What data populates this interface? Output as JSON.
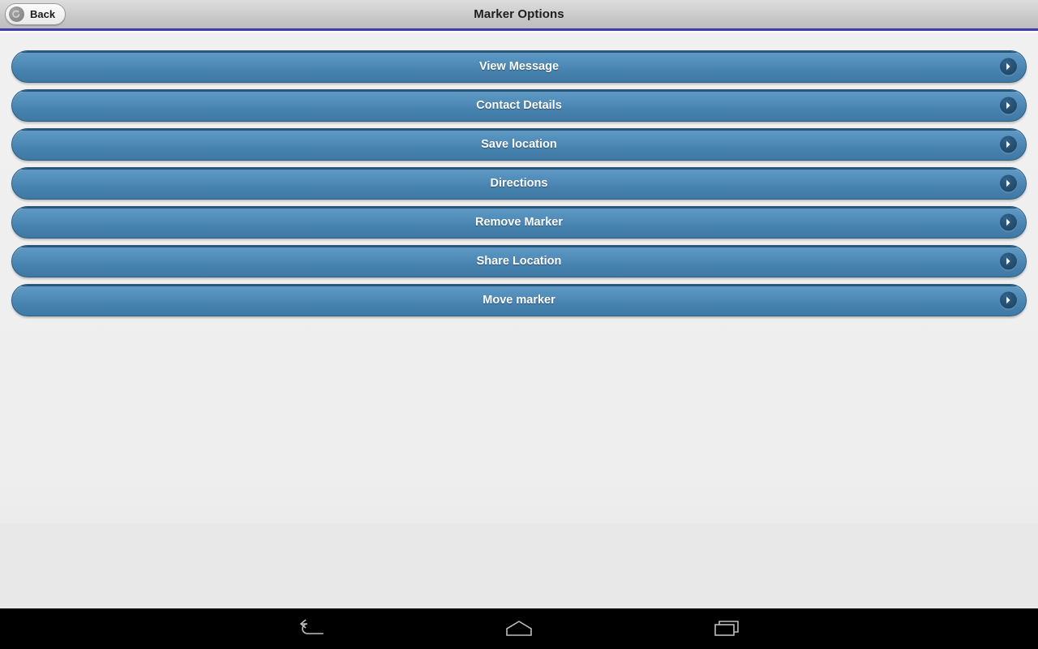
{
  "titlebar": {
    "title": "Marker Options",
    "back_label": "Back",
    "back_icon": "back-circle-arrow-icon",
    "accent_color": "#3c3cab"
  },
  "theme": {
    "button_blue_top": "#619ac6",
    "button_blue_bottom": "#3f79a5",
    "button_border": "#2d5e84",
    "button_text": "#ffffff",
    "content_background": "#eeeeee",
    "navbar_background": "#000000"
  },
  "main": {
    "options": [
      {
        "label": "View Message",
        "chevron": "chevron-right-icon"
      },
      {
        "label": "Contact Details",
        "chevron": "chevron-right-icon"
      },
      {
        "label": "Save location",
        "chevron": "chevron-right-icon"
      },
      {
        "label": "Directions",
        "chevron": "chevron-right-icon"
      },
      {
        "label": "Remove Marker",
        "chevron": "chevron-right-icon"
      },
      {
        "label": "Share Location",
        "chevron": "chevron-right-icon"
      },
      {
        "label": "Move marker",
        "chevron": "chevron-right-icon"
      }
    ]
  },
  "navbar": {
    "buttons": [
      {
        "name": "back",
        "icon": "back-arrow-icon"
      },
      {
        "name": "home",
        "icon": "home-icon"
      },
      {
        "name": "recents",
        "icon": "recent-apps-icon"
      }
    ]
  }
}
